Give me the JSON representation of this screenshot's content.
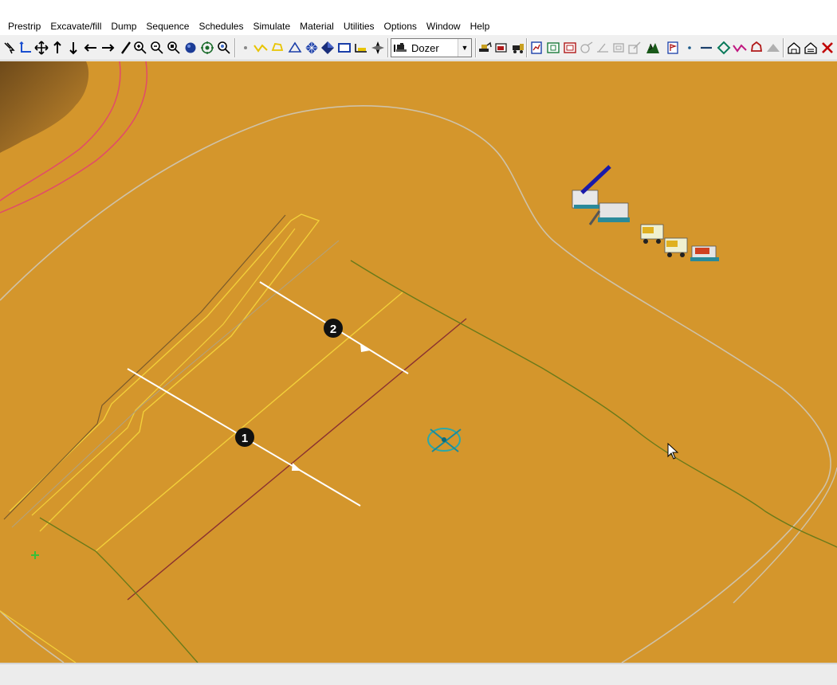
{
  "menu": {
    "items": [
      "Prestrip",
      "Excavate/fill",
      "Dump",
      "Sequence",
      "Schedules",
      "Simulate",
      "Material",
      "Utilities",
      "Options",
      "Window",
      "Help"
    ]
  },
  "toolbar": {
    "equipment_select": {
      "value": "Dozer"
    }
  },
  "map": {
    "background_color": "#d4962c",
    "marker_1_label": "1",
    "marker_2_label": "2"
  }
}
